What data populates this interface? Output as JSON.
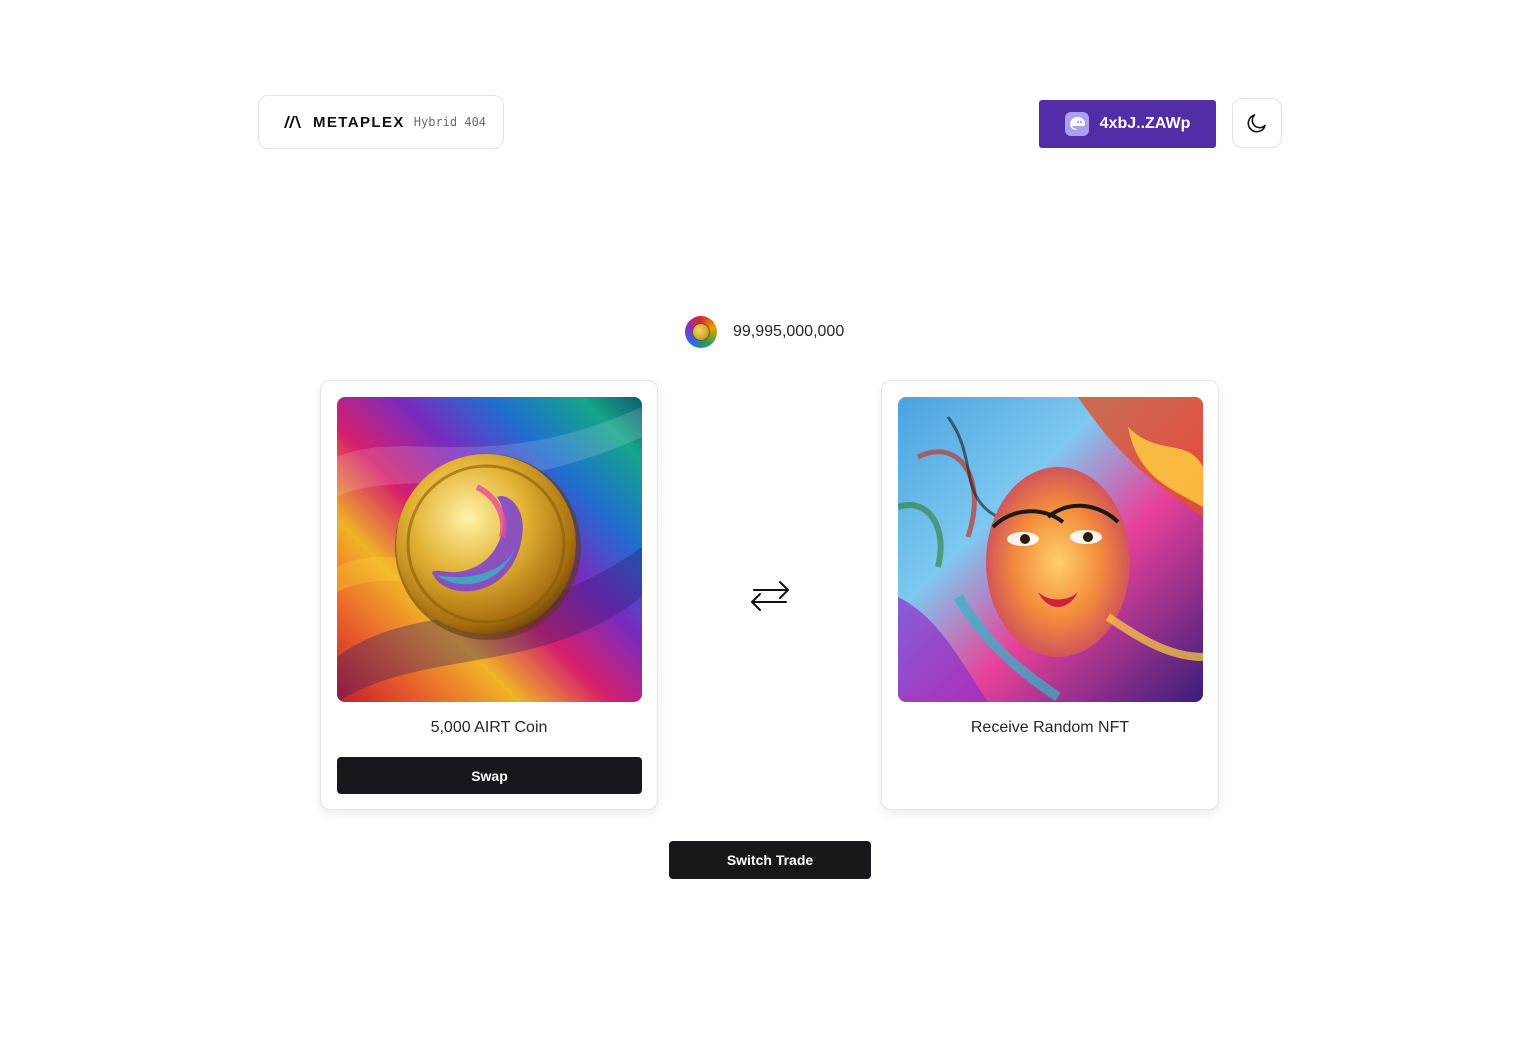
{
  "header": {
    "brand_name": "METAPLEX",
    "brand_sub": "Hybrid 404",
    "wallet_label": "4xbJ..ZAWp",
    "theme_icon": "moon-icon"
  },
  "balance": {
    "token_icon": "coin-icon",
    "amount": "99,995,000,000"
  },
  "trade": {
    "left_card": {
      "image_alt": "coin-artwork",
      "label": "5,000 AIRT Coin",
      "button_label": "Swap"
    },
    "right_card": {
      "image_alt": "nft-artwork",
      "label": "Receive Random NFT"
    },
    "swap_icon": "arrows-exchange-icon",
    "switch_label": "Switch Trade"
  },
  "colors": {
    "wallet_button": "#512da8",
    "primary_button": "#18181b",
    "border": "#e4e4e7"
  }
}
